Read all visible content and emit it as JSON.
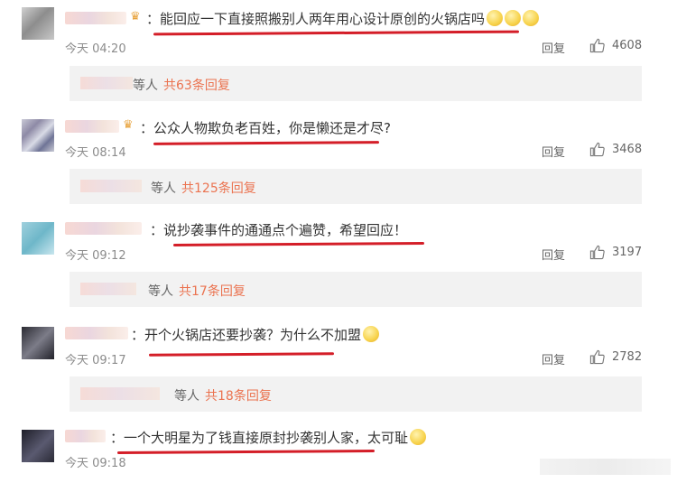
{
  "comments": [
    {
      "text": "：能回应一下直接照搬别人两年用心设计原创的火锅店吗",
      "time": "今天 04:20",
      "reply_label": "回复",
      "likes": "4608",
      "reply_suffix": "等人",
      "reply_link": "共63条回复"
    },
    {
      "text": "：公众人物欺负老百姓，你是懒还是才尽?",
      "time": "今天 08:14",
      "reply_label": "回复",
      "likes": "3468",
      "reply_suffix": "等人",
      "reply_link": "共125条回复"
    },
    {
      "text": "：说抄袭事件的通通点个遍赞，希望回应！",
      "time": "今天 09:12",
      "reply_label": "回复",
      "likes": "3197",
      "reply_suffix": "等人",
      "reply_link": "共17条回复"
    },
    {
      "text": "：开个火锅店还要抄袭？为什么不加盟",
      "time": "今天 09:17",
      "reply_label": "回复",
      "likes": "2782",
      "reply_suffix": "等人",
      "reply_link": "共18条回复"
    },
    {
      "text": "：一个大明星为了钱直接原封抄袭别人家，太可耻",
      "time": "今天 09:18"
    }
  ],
  "icons": {
    "like": "thumbs-up-icon",
    "verified": "crown-badge-icon",
    "emoji": "smile-emoji-icon"
  },
  "colors": {
    "link": "#eb7350",
    "underline": "#d41e28",
    "reply_bg": "#f2f2f2"
  }
}
